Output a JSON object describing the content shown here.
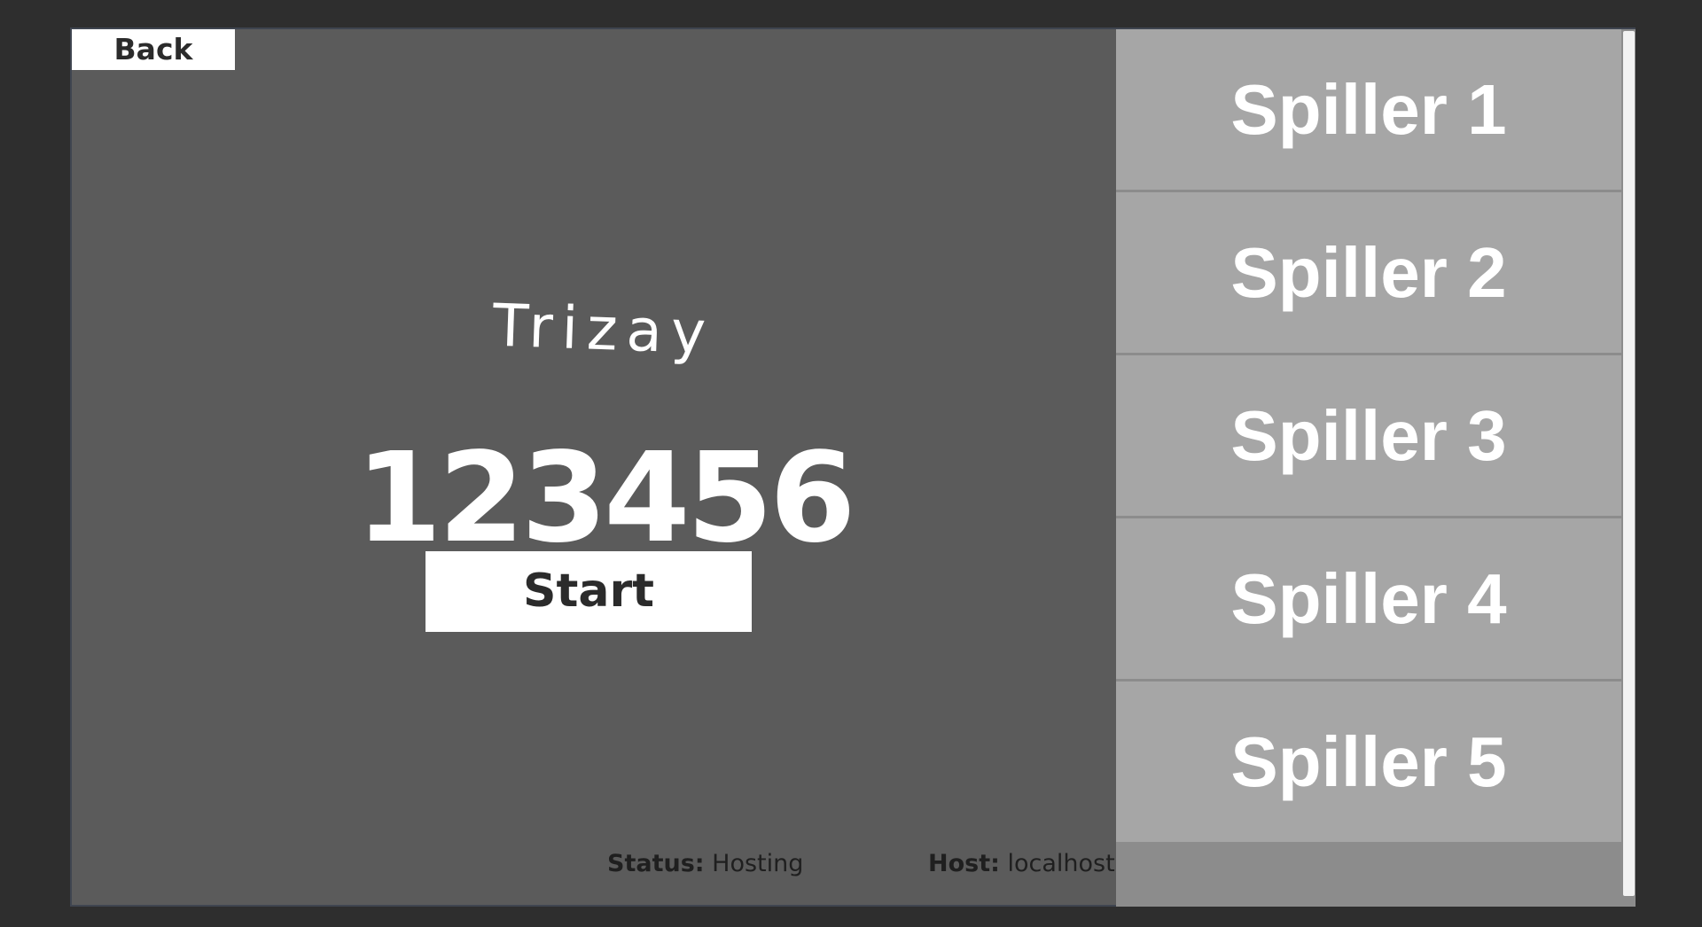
{
  "back_button": {
    "label": "Back"
  },
  "game": {
    "title": "Trizay",
    "code": "123456",
    "start_label": "Start"
  },
  "status": {
    "status_label": "Status:",
    "status_value": "Hosting",
    "host_label": "Host:",
    "host_value": "localhost"
  },
  "players": [
    {
      "label": "Spiller 1"
    },
    {
      "label": "Spiller 2"
    },
    {
      "label": "Spiller 3"
    },
    {
      "label": "Spiller 4"
    },
    {
      "label": "Spiller 5"
    }
  ],
  "colors": {
    "background": "#2e2e2e",
    "panel": "#5b5b5b",
    "player_slot": "#a6a6a6",
    "player_panel_bg": "#8c8c8c",
    "button_bg": "#ffffff",
    "button_text": "#2b2b2b"
  }
}
